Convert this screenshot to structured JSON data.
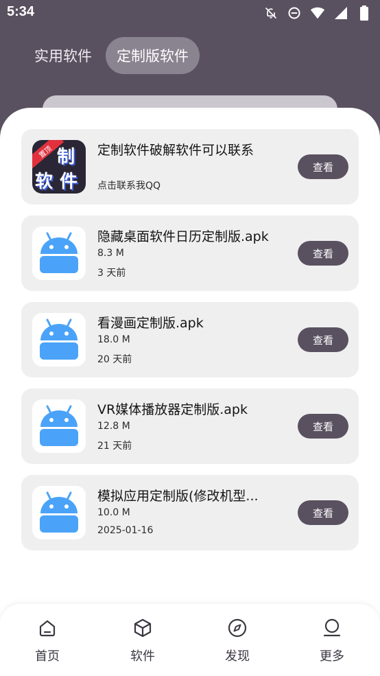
{
  "status_bar": {
    "time": "5:34",
    "icons": [
      "notifications-off-icon",
      "do-not-disturb-icon",
      "wifi-icon",
      "signal-icon",
      "battery-icon"
    ]
  },
  "tabs": [
    {
      "label": "实用软件",
      "active": false
    },
    {
      "label": "定制版软件",
      "active": true
    }
  ],
  "apps": [
    {
      "title": "定制软件破解软件可以联系",
      "line1": "",
      "line2": "点击联系我QQ",
      "icon": "custom-software-promo-icon",
      "button": "查看"
    },
    {
      "title": "隐藏桌面软件日历定制版.apk",
      "line1": "8.3 M",
      "line2": "3 天前",
      "icon": "android-icon",
      "button": "查看"
    },
    {
      "title": "看漫画定制版.apk",
      "line1": "18.0 M",
      "line2": "20 天前",
      "icon": "android-icon",
      "button": "查看"
    },
    {
      "title": "VR媒体播放器定制版.apk",
      "line1": "12.8 M",
      "line2": "21 天前",
      "icon": "android-icon",
      "button": "查看"
    },
    {
      "title": "模拟应用定制版(修改机型...",
      "line1": "10.0 M",
      "line2": "2025-01-16",
      "icon": "android-icon",
      "button": "查看"
    }
  ],
  "promo_icon_text": {
    "ribbon": "置顶",
    "chars": [
      "定",
      "制",
      "软",
      "件"
    ]
  },
  "bottom_nav": [
    {
      "label": "首页",
      "icon": "home-icon"
    },
    {
      "label": "软件",
      "icon": "cube-icon"
    },
    {
      "label": "发现",
      "icon": "compass-icon"
    },
    {
      "label": "更多",
      "icon": "person-icon"
    }
  ],
  "colors": {
    "header_bg": "#5a5160",
    "button_bg": "#5a5160",
    "card_bg": "#efefef",
    "android_blue": "#4aa3f8"
  }
}
